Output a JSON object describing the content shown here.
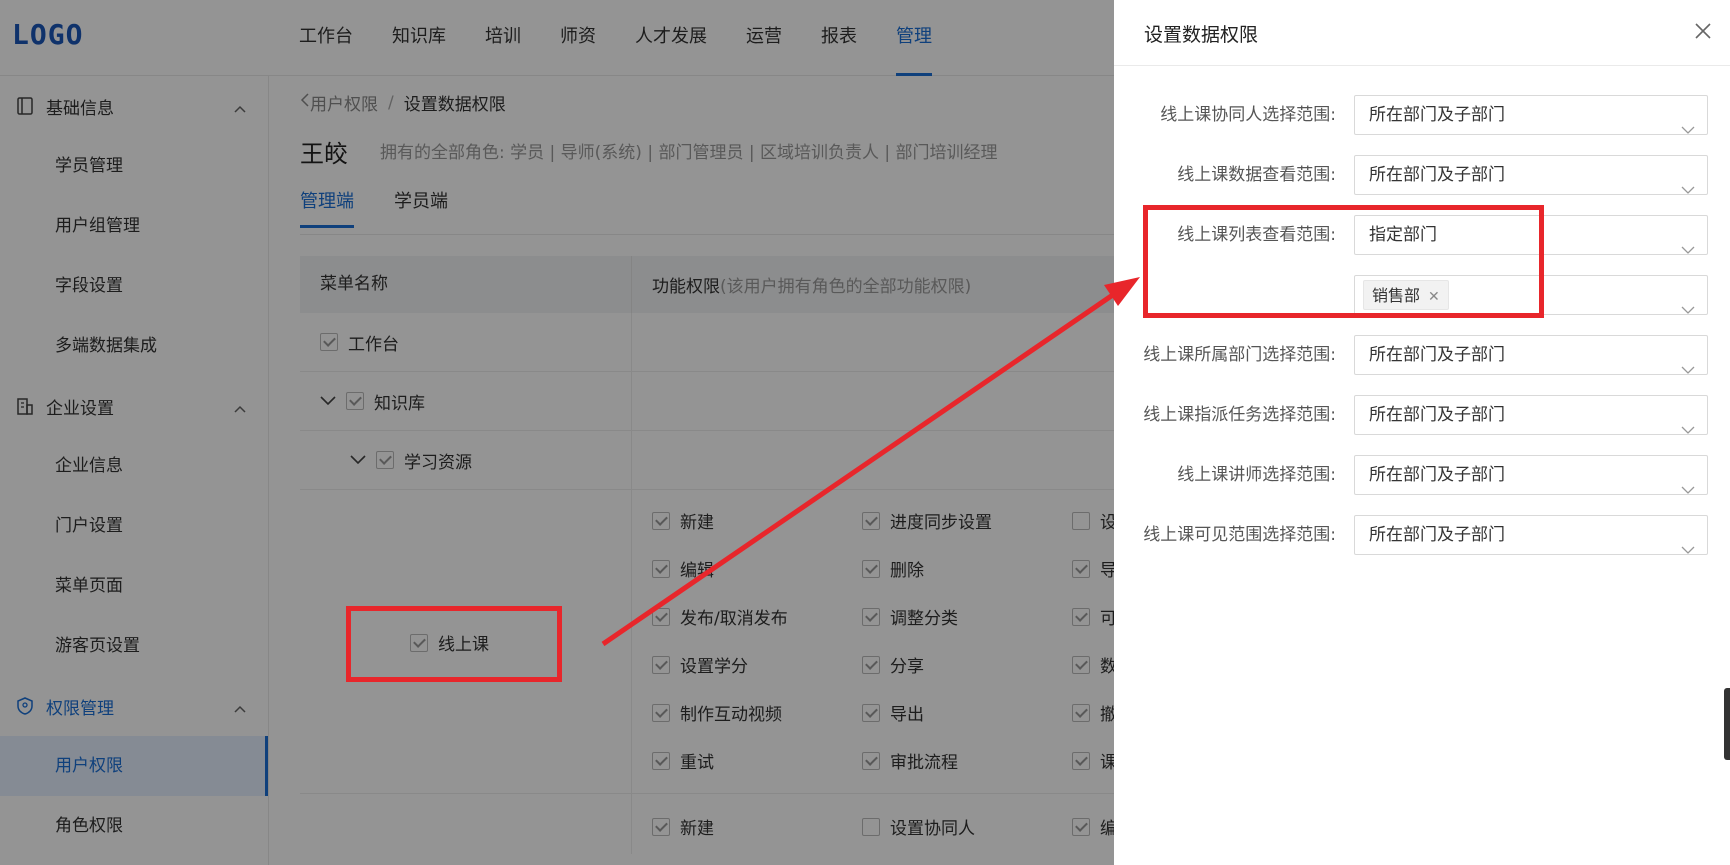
{
  "logo": "LOGO",
  "nav": [
    "工作台",
    "知识库",
    "培训",
    "师资",
    "人才发展",
    "运营",
    "报表",
    "管理"
  ],
  "nav_active_index": 7,
  "sidebar": {
    "groups": [
      {
        "label": "基础信息",
        "items": [
          "学员管理",
          "用户组管理",
          "字段设置",
          "多端数据集成"
        ]
      },
      {
        "label": "企业设置",
        "items": [
          "企业信息",
          "门户设置",
          "菜单页面",
          "游客页设置"
        ]
      },
      {
        "label": "权限管理",
        "items": [
          "用户权限",
          "角色权限"
        ]
      }
    ],
    "active_item": "用户权限"
  },
  "breadcrumb": {
    "back": "用户权限",
    "sep": "/",
    "current": "设置数据权限"
  },
  "user": {
    "name": "王皎",
    "roles_label": "拥有的全部角色:",
    "roles": "学员 | 导师(系统) | 部门管理员 | 区域培训负责人 | 部门培训经理"
  },
  "tabs": [
    "管理端",
    "学员端"
  ],
  "table": {
    "col1": "菜单名称",
    "col2": "功能权限",
    "col2_note": "(该用户拥有角色的全部功能权限)",
    "rows": {
      "workbench": "工作台",
      "knowledge": "知识库",
      "resource": "学习资源",
      "online": "线上课"
    },
    "perms_col1": [
      "新建",
      "编辑",
      "发布/取消发布",
      "设置学分",
      "制作互动视频",
      "重试"
    ],
    "perms_col2": [
      "进度同步设置",
      "删除",
      "调整分类",
      "分享",
      "导出",
      "审批流程"
    ],
    "perms_col3": [
      "设",
      "导",
      "可",
      "数",
      "撤",
      "课"
    ],
    "perms_col3_checked": [
      false,
      true,
      true,
      true,
      true,
      true
    ],
    "next_row": [
      "新建",
      "设置协同人",
      "编"
    ],
    "next_row_checked": [
      true,
      false,
      true
    ]
  },
  "drawer": {
    "title": "设置数据权限",
    "fields": [
      {
        "label": "线上课协同人选择范围:",
        "value": "所在部门及子部门"
      },
      {
        "label": "线上课数据查看范围:",
        "value": "所在部门及子部门"
      },
      {
        "label": "线上课列表查看范围:",
        "value": "指定部门"
      },
      {
        "label": "",
        "value": "",
        "tag": "销售部"
      },
      {
        "label": "线上课所属部门选择范围:",
        "value": "所在部门及子部门"
      },
      {
        "label": "线上课指派任务选择范围:",
        "value": "所在部门及子部门"
      },
      {
        "label": "线上课讲师选择范围:",
        "value": "所在部门及子部门"
      },
      {
        "label": "线上课可见范围选择范围:",
        "value": "所在部门及子部门"
      }
    ]
  },
  "colors": {
    "accent": "#1a6fd6",
    "annotation": "#e8262b"
  }
}
